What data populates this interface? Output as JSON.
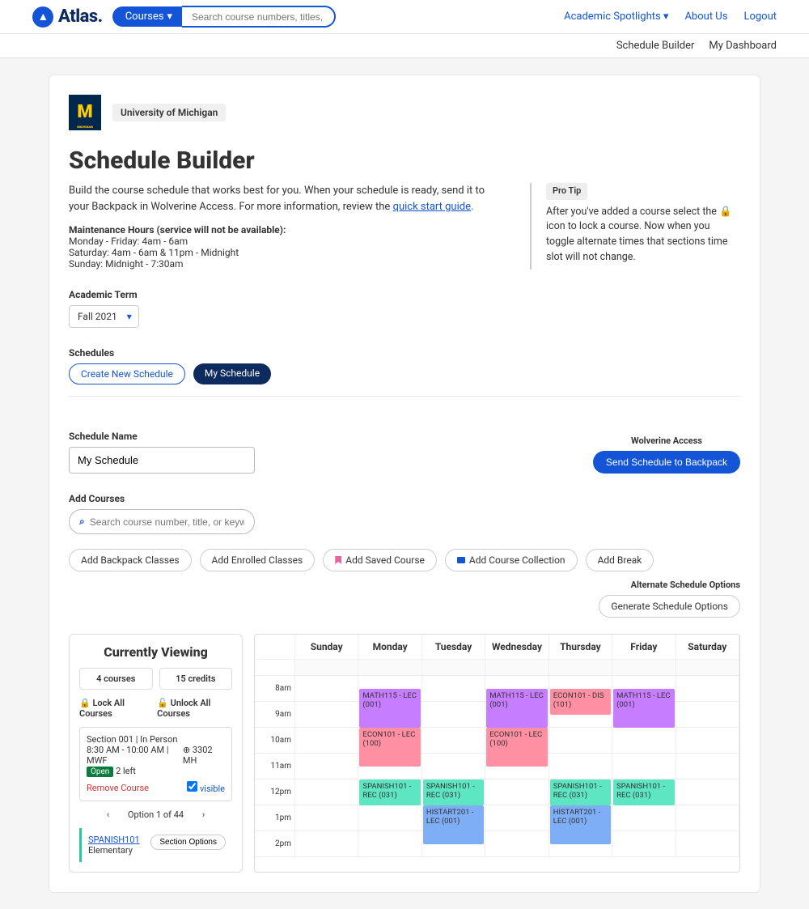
{
  "brand": "Atlas.",
  "search_dropdown": "Courses",
  "search_placeholder": "Search course numbers, titles, or keywords",
  "topnav": {
    "spotlights": "Academic Spotlights",
    "about": "About Us",
    "logout": "Logout"
  },
  "subnav": {
    "builder": "Schedule Builder",
    "dashboard": "My Dashboard"
  },
  "university": "University of Michigan",
  "page_title": "Schedule Builder",
  "description": "Build the course schedule that works best for you. When your schedule is ready, send it to your Backpack in Wolverine Access. For more information, review the ",
  "guide_link": "quick start guide",
  "maint_heading": "Maintenance Hours (service will not be available):",
  "maint_weekday": "Monday - Friday: 4am - 6am",
  "maint_saturday": "Saturday: 4am - 6am & 11pm - Midnight",
  "maint_sunday": "Sunday: Midnight - 7:30am",
  "tip_label": "Pro Tip",
  "tip_text": "After you've added a course select the 🔒 icon to lock a course. Now when you toggle alternate times that sections time slot will not change.",
  "term_label": "Academic Term",
  "term_value": "Fall 2021",
  "schedules_label": "Schedules",
  "create_new": "Create New Schedule",
  "my_schedule": "My Schedule",
  "schedule_name_label": "Schedule Name",
  "schedule_name_value": "My Schedule",
  "wolverine_label": "Wolverine Access",
  "send_backpack": "Send Schedule to Backpack",
  "add_courses_label": "Add Courses",
  "course_search_placeholder": "Search course number, title, or keywords",
  "buttons": {
    "add_backpack": "Add Backpack Classes",
    "add_enrolled": "Add Enrolled Classes",
    "add_saved": "Add Saved Course",
    "add_collection": "Add Course Collection",
    "add_break": "Add Break"
  },
  "alt_label": "Alternate Schedule Options",
  "generate": "Generate Schedule Options",
  "sidebar": {
    "title": "Currently Viewing",
    "courses": "4 courses",
    "credits": "15 credits",
    "lock_all": "Lock All Courses",
    "unlock_all": "Unlock All Courses",
    "section_line1": "Section 001 | In Person",
    "section_line2": "8:30 AM - 10:00 AM | MWF",
    "section_room": "3302 MH",
    "open": "Open",
    "left": "2 left",
    "remove": "Remove Course",
    "visible": "visible",
    "pager": "Option 1 of 44",
    "spanish": "SPANISH101",
    "spanish_sub": "Elementary",
    "section_options": "Section Options"
  },
  "days": [
    "Sunday",
    "Monday",
    "Tuesday",
    "Wednesday",
    "Thursday",
    "Friday",
    "Saturday"
  ],
  "times": [
    "8am",
    "9am",
    "10am",
    "11am",
    "12pm",
    "1pm",
    "2pm"
  ],
  "events": {
    "math": "MATH115 - LEC (001)",
    "econ_lec": "ECON101 - LEC (100)",
    "econ_dis": "ECON101 - DIS (101)",
    "spanish": "SPANISH101 - REC (031)",
    "histart": "HISTART201 - LEC (001)"
  }
}
